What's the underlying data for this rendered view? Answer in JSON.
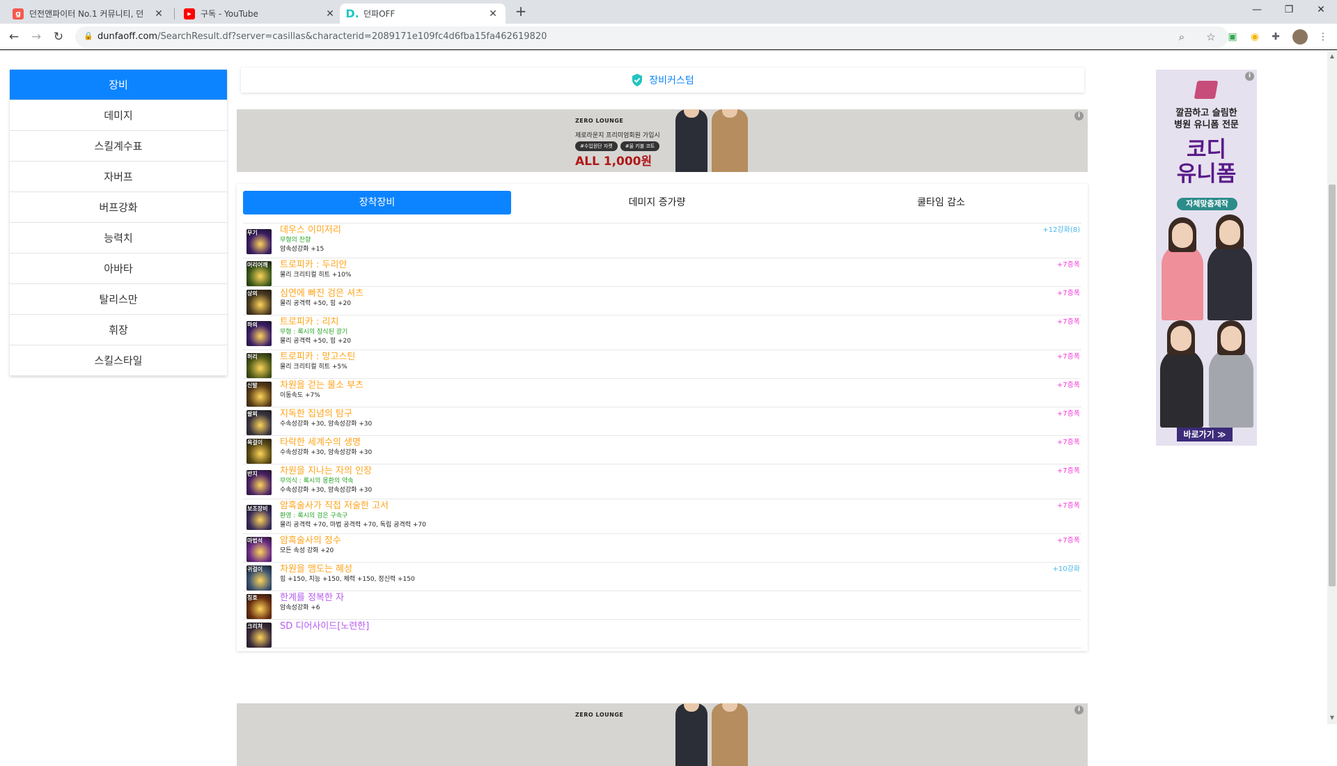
{
  "browser": {
    "tabs": [
      {
        "title": "던전앤파이터 No.1 커뮤니티, 던",
        "favicon": "g",
        "favicon_color": "#f45a4f",
        "active": false
      },
      {
        "title": "구독 - YouTube",
        "favicon": "▶",
        "favicon_color": "#ff0000",
        "active": false
      },
      {
        "title": "던파OFF",
        "favicon": "D.",
        "favicon_color": "#1fc8c0",
        "active": true
      }
    ],
    "url_host": "dunfaoff.com",
    "url_path": "/SearchResult.df?server=casillas&characterid=2089171e109fc4d6fba15fa462619820"
  },
  "left_menu": [
    {
      "label": "장비",
      "active": true
    },
    {
      "label": "데미지",
      "active": false
    },
    {
      "label": "스킬계수표",
      "active": false
    },
    {
      "label": "자버프",
      "active": false
    },
    {
      "label": "버프강화",
      "active": false
    },
    {
      "label": "능력치",
      "active": false
    },
    {
      "label": "아바타",
      "active": false
    },
    {
      "label": "탈리스만",
      "active": false
    },
    {
      "label": "휘장",
      "active": false
    },
    {
      "label": "스킬스타일",
      "active": false
    }
  ],
  "custom_button": {
    "label": "장비커스텀"
  },
  "ad_banner": {
    "brand": "ZERO LOUNGE",
    "line": "제로라운지 프리미엄회원 가입시",
    "pills": [
      "#수입원단 자켓",
      "#울 키블 코트"
    ],
    "headline": "ALL 1,000원",
    "info": "i"
  },
  "equip_tabs": [
    {
      "label": "장착장비",
      "active": true
    },
    {
      "label": "데미지 증가량",
      "active": false
    },
    {
      "label": "쿨타임 감소",
      "active": false
    }
  ],
  "equipment": [
    {
      "slot": "무기",
      "name": "데우스 이미저리",
      "name_color": "orange",
      "lines": [
        {
          "text": "무형의 잔향",
          "color": "green"
        },
        {
          "text": "암속성강화 +15",
          "color": "dark"
        }
      ],
      "enhance": "+12강화(8)",
      "enhance_color": "blue",
      "icon_bg": "#3a1b66"
    },
    {
      "slot": "머리어깨",
      "name": "트로피카 : 두리안",
      "name_color": "orange",
      "lines": [
        {
          "text": "물리 크리티컬 히트 +10%",
          "color": "dark"
        }
      ],
      "enhance": "+7증폭",
      "enhance_color": "pink",
      "icon_bg": "#3d5a1a"
    },
    {
      "slot": "상의",
      "name": "심연에 빠진 검은 셔츠",
      "name_color": "orange",
      "lines": [
        {
          "text": "물리 공격력 +50, 힘 +20",
          "color": "dark"
        }
      ],
      "enhance": "+7증폭",
      "enhance_color": "pink",
      "icon_bg": "#4a3a20"
    },
    {
      "slot": "하의",
      "name": "트로피카 : 리치",
      "name_color": "orange",
      "lines": [
        {
          "text": "무형 : 록시의 잠식된 광기",
          "color": "green"
        },
        {
          "text": "물리 공격력 +50, 힘 +20",
          "color": "dark"
        }
      ],
      "enhance": "+7증폭",
      "enhance_color": "pink",
      "icon_bg": "#3b1e68"
    },
    {
      "slot": "허리",
      "name": "트로피카 : 망고스틴",
      "name_color": "orange",
      "lines": [
        {
          "text": "물리 크리티컬 히트 +5%",
          "color": "dark"
        }
      ],
      "enhance": "+7증폭",
      "enhance_color": "pink",
      "icon_bg": "#4f5a18"
    },
    {
      "slot": "신발",
      "name": "차원을 걷는 물소 부츠",
      "name_color": "orange",
      "lines": [
        {
          "text": "이동속도 +7%",
          "color": "dark"
        }
      ],
      "enhance": "+7증폭",
      "enhance_color": "pink",
      "icon_bg": "#5a3d16"
    },
    {
      "slot": "팔찌",
      "name": "지독한 집념의 탐구",
      "name_color": "orange",
      "lines": [
        {
          "text": "수속성강화 +30, 암속성강화 +30",
          "color": "dark"
        }
      ],
      "enhance": "+7증폭",
      "enhance_color": "pink",
      "icon_bg": "#3a3440"
    },
    {
      "slot": "목걸이",
      "name": "타락한 세계수의 생명",
      "name_color": "orange",
      "lines": [
        {
          "text": "수속성강화 +30, 암속성강화 +30",
          "color": "dark"
        }
      ],
      "enhance": "+7증폭",
      "enhance_color": "pink",
      "icon_bg": "#5a4a14"
    },
    {
      "slot": "반지",
      "name": "차원을 지나는 자의 인장",
      "name_color": "orange",
      "lines": [
        {
          "text": "무의식 : 록시의 몽환의 약속",
          "color": "green"
        },
        {
          "text": "수속성강화 +30, 암속성강화 +30",
          "color": "dark"
        }
      ],
      "enhance": "+7증폭",
      "enhance_color": "pink",
      "icon_bg": "#4a2266"
    },
    {
      "slot": "보조장비",
      "name": "암흑술사가 직접 저술한 고서",
      "name_color": "orange",
      "lines": [
        {
          "text": "환영 : 록시의 검은 구속구",
          "color": "green"
        },
        {
          "text": "물리 공격력 +70, 마법 공격력 +70, 독립 공격력 +70",
          "color": "dark"
        }
      ],
      "enhance": "+7증폭",
      "enhance_color": "pink",
      "icon_bg": "#3a2c5c"
    },
    {
      "slot": "마법석",
      "name": "암흑술사의 정수",
      "name_color": "orange",
      "lines": [
        {
          "text": "모든 속성 강화 +20",
          "color": "dark"
        }
      ],
      "enhance": "+7증폭",
      "enhance_color": "pink",
      "icon_bg": "#6a2a88"
    },
    {
      "slot": "귀걸이",
      "name": "차원을 맴도는 혜성",
      "name_color": "orange",
      "lines": [
        {
          "text": "힘 +150, 지능 +150, 체력 +150, 정신력 +150",
          "color": "dark"
        }
      ],
      "enhance": "+10강화",
      "enhance_color": "blue",
      "icon_bg": "#3a5270"
    },
    {
      "slot": "칭호",
      "name": "한계를 정복한 자",
      "name_color": "purple",
      "lines": [
        {
          "text": "암속성강화 +6",
          "color": "dark"
        }
      ],
      "enhance": "",
      "enhance_color": "blue",
      "icon_bg": "#6a3010"
    },
    {
      "slot": "크리쳐",
      "name": "SD 디어사이드[노련한]",
      "name_color": "purple",
      "lines": [],
      "enhance": "",
      "enhance_color": "blue",
      "icon_bg": "#3a2a3a"
    }
  ],
  "right_ad": {
    "line1": "깔끔하고 슬림한",
    "line2": "병원 유니폼 전문",
    "headline1": "코디",
    "headline2": "유니폼",
    "tag": "자체맞춤제작",
    "cta": "바로가기 ≫"
  },
  "colors": {
    "accent": "#0d84ff",
    "orange": "#ffa41c",
    "purple": "#b65bf0",
    "green": "#25a325",
    "pink": "#f23bd8",
    "blue": "#48b7e8"
  }
}
